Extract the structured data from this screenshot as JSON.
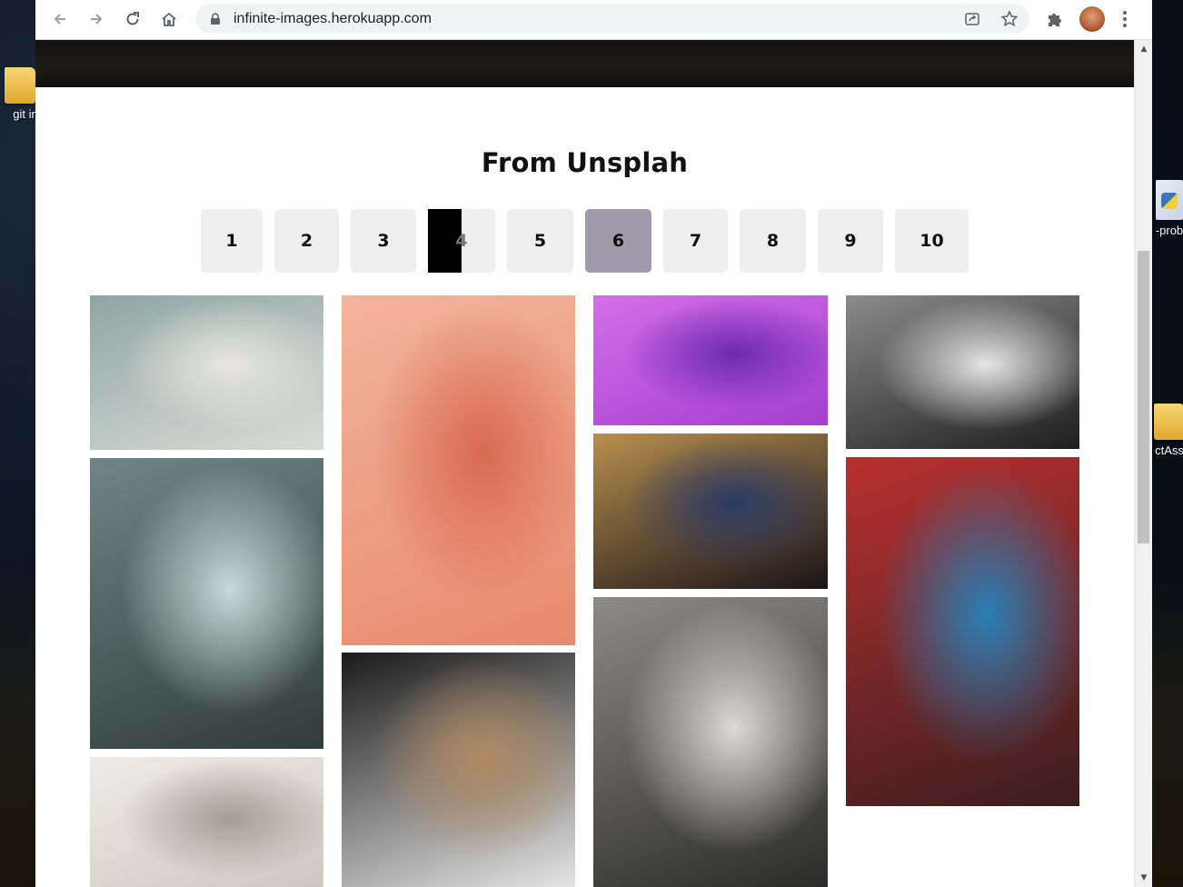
{
  "browser": {
    "url": "infinite-images.herokuapp.com",
    "nav": {
      "back_icon": "arrow-left-icon",
      "forward_icon": "arrow-right-icon",
      "reload_icon": "reload-icon",
      "home_icon": "home-icon"
    },
    "actions": {
      "share_icon": "share-icon",
      "bookmark_icon": "star-icon",
      "extensions_icon": "puzzle-icon",
      "menu_icon": "kebab-menu-icon"
    }
  },
  "desktop": {
    "icons": [
      {
        "label": "git in"
      },
      {
        "label": "-prob"
      },
      {
        "label": "ctAss"
      }
    ]
  },
  "page": {
    "title": "From Unsplah",
    "pagination": [
      "1",
      "2",
      "3",
      "4",
      "5",
      "6",
      "7",
      "8",
      "9",
      "10"
    ],
    "active_page": "6"
  },
  "colors": {
    "active_page_bg": "#a09bab",
    "page_btn_bg": "#eeeeee"
  },
  "gallery": {
    "images": [
      {
        "name": "laptop-on-bench",
        "colors": [
          "#d9dcd8",
          "#8fa6a3",
          "#e9e6df"
        ]
      },
      {
        "name": "snowy-forest-cabin",
        "colors": [
          "#2f3d3b",
          "#6f8585",
          "#c9d8d8"
        ]
      },
      {
        "name": "white-fur-blanket",
        "colors": [
          "#cdc7c0",
          "#efebe6",
          "#a49d95"
        ]
      },
      {
        "name": "person-pink-hat-striped-pants",
        "colors": [
          "#e98a6e",
          "#f2b49c",
          "#d96a52"
        ]
      },
      {
        "name": "sony-camera-hands",
        "colors": [
          "#e6e6e6",
          "#1a1a1a",
          "#b28a62"
        ]
      },
      {
        "name": "purple-coins-falling",
        "colors": [
          "#a43ed1",
          "#d56ee6",
          "#6a2bb0"
        ]
      },
      {
        "name": "child-christmas-lights",
        "colors": [
          "#1a1418",
          "#b88f4e",
          "#2c3b66"
        ]
      },
      {
        "name": "christmas-tree-living-room",
        "colors": [
          "#2a2b2a",
          "#8e8b86",
          "#ddd9d2"
        ]
      },
      {
        "name": "calligraphy-black-white",
        "colors": [
          "#1e1e1e",
          "#8b8b8b",
          "#e6e6e6"
        ]
      },
      {
        "name": "woman-parking-garage-neon",
        "colors": [
          "#3b1d1e",
          "#b8302f",
          "#2a7fb6"
        ]
      }
    ]
  }
}
